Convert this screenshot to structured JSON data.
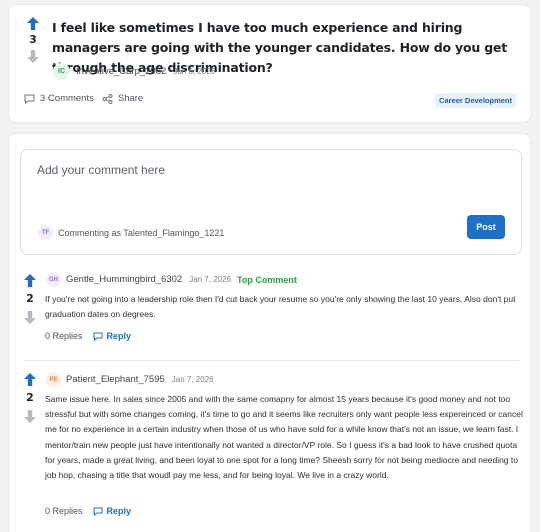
{
  "post": {
    "votes": "3",
    "title": "I feel like sometimes I have too much experience and hiring managers are going with the younger candidates. How do you get through the age discrimination?",
    "author_initials": "IC",
    "author": "Inventive_Carp_2982",
    "date": "Jan 6, 2026",
    "comments_label": "3 Comments",
    "share_label": "Share",
    "tag": "Career Development"
  },
  "editor": {
    "placeholder": "Add your comment here",
    "commenting_initials": "TF",
    "commenting_as": "Commenting as Talented_Flamingo_1221",
    "post_label": "Post"
  },
  "comments": [
    {
      "votes": "2",
      "initials": "GH",
      "author": "Gentle_Hummingbird_6302",
      "date": "Jan 7, 2026",
      "badge": "Top Comment",
      "body": "If you're not going into a leadership role then I'd cut back your resume so you're only showing the last 10 years. Also don't put graduation dates on degrees.",
      "replies": "0 Replies",
      "reply_label": "Reply"
    },
    {
      "votes": "2",
      "initials": "PE",
      "author": "Patient_Elephant_7595",
      "date": "Jan 7, 2026",
      "badge": "",
      "body": "Same issue here. In sales since 2005 and with the same comapny for almost 15 years because it's good money and not too stressful but with some changes coming, it's time to go and it seems like recruiters only want people less expereinced or cancel me for no experience in a certain industry when those of us who have sold for a while know that's not an issue, we learn fast. I mentor/train new people just have intentionally not wanted a director/VP role. So I guess it's a bad look to have crushed quota for years, made a great living, and been loyal to one spot for a long time? Sheesh sorry for not being mediocre and needing to job hop, chasing a title that woudl pay me less, and for being loyal. We live in a crazy world.",
      "replies": "0 Replies",
      "reply_label": "Reply"
    }
  ],
  "colors": {
    "upvote": "#1f6fc7",
    "downvote": "#b5bac0",
    "accent": "#1f6fc7",
    "top_comment": "#2ea043"
  },
  "icons": [
    "arrow-up-icon",
    "arrow-down-icon",
    "comment-icon",
    "share-icon",
    "reply-icon"
  ]
}
